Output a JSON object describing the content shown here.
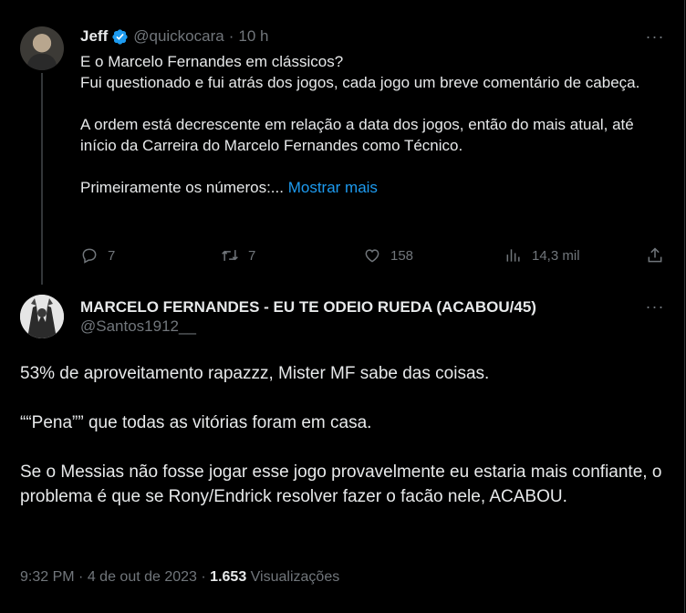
{
  "parent": {
    "name": "Jeff",
    "handle": "@quickocara",
    "separator": "·",
    "time": "10 h",
    "lines": [
      "E o Marcelo Fernandes em clássicos?",
      "Fui questionado e fui atrás dos jogos, cada jogo um breve comentário de cabeça.",
      "",
      "A ordem está decrescente em relação a data dos jogos, então do mais atual, até início da Carreira do Marcelo Fernandes como Técnico.",
      "",
      "Primeiramente os números:..."
    ],
    "show_more": "Mostrar mais",
    "actions": {
      "replies": "7",
      "retweets": "7",
      "likes": "158",
      "views": "14,3 mil"
    },
    "icons": [
      "verified-badge-icon",
      "more-icon",
      "reply-icon",
      "retweet-icon",
      "like-icon",
      "views-icon",
      "share-icon"
    ]
  },
  "reply": {
    "name": "MARCELO FERNANDES - EU TE ODEIO RUEDA (ACABOU/45)",
    "handle": "@Santos1912__",
    "paragraphs": [
      "53% de aproveitamento rapazzz, Mister MF sabe das coisas.",
      "",
      "““Pena”” que todas as vitórias foram em casa.",
      "",
      "Se o Messias não fosse jogar esse jogo provavelmente eu estaria mais confiante, o problema é que se Rony/Endrick resolver fazer o facão nele, ACABOU."
    ],
    "time": "9:32 PM",
    "date": "4 de out de 2023",
    "separator": "·",
    "view_count": "1.653",
    "views_label": "Visualizações"
  },
  "colors": {
    "background": "#000000",
    "text": "#e7e9ea",
    "secondary": "#71767b",
    "accent": "#1d9bf0",
    "border": "#2f3336"
  }
}
